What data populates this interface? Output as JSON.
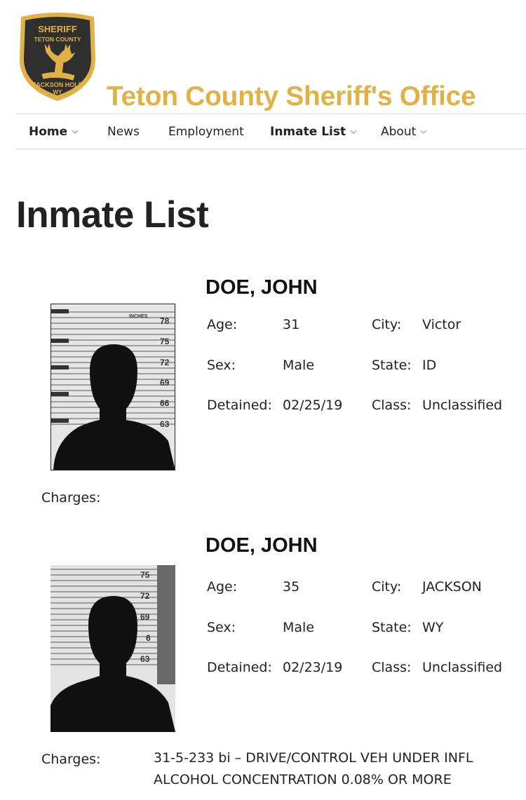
{
  "header": {
    "badge": {
      "line1": "SHERIFF",
      "line2": "TETON COUNTY",
      "line3": "JACKSON HOLE",
      "line4": "WY"
    },
    "site_title": "Teton County Sheriff's Office",
    "accent_color": "#e0b245",
    "badge_color": "#2f2f2f"
  },
  "nav": {
    "items": [
      {
        "label": "Home",
        "dropdown": true,
        "bold": true
      },
      {
        "label": "News",
        "dropdown": false,
        "bold": false
      },
      {
        "label": "Employment",
        "dropdown": false,
        "bold": false
      },
      {
        "label": "Inmate List",
        "dropdown": true,
        "bold": true
      },
      {
        "label": "About",
        "dropdown": true,
        "bold": false
      }
    ]
  },
  "page_title": "Inmate List",
  "labels": {
    "age": "Age:",
    "sex": "Sex:",
    "detained": "Detained:",
    "city": "City:",
    "state": "State:",
    "class": "Class:",
    "charges": "Charges:"
  },
  "inmates": [
    {
      "name": "DOE, JOHN",
      "age": "31",
      "sex": "Male",
      "detained": "02/25/19",
      "city": "Victor",
      "state": "ID",
      "class": "Unclassified",
      "mugshot_scale": [
        "INCHES",
        "78",
        "75",
        "72",
        "69",
        "66",
        "63"
      ],
      "charges": []
    },
    {
      "name": "DOE, JOHN",
      "age": "35",
      "sex": "Male",
      "detained": "02/23/19",
      "city": "JACKSON",
      "state": "WY",
      "class": "Unclassified",
      "mugshot_scale": [
        "75",
        "72",
        "69",
        "6",
        "63"
      ],
      "charges": [
        "31-5-233 bi – DRIVE/CONTROL VEH UNDER INFL",
        "ALCOHOL CONCENTRATION 0.08% OR MORE"
      ]
    }
  ]
}
